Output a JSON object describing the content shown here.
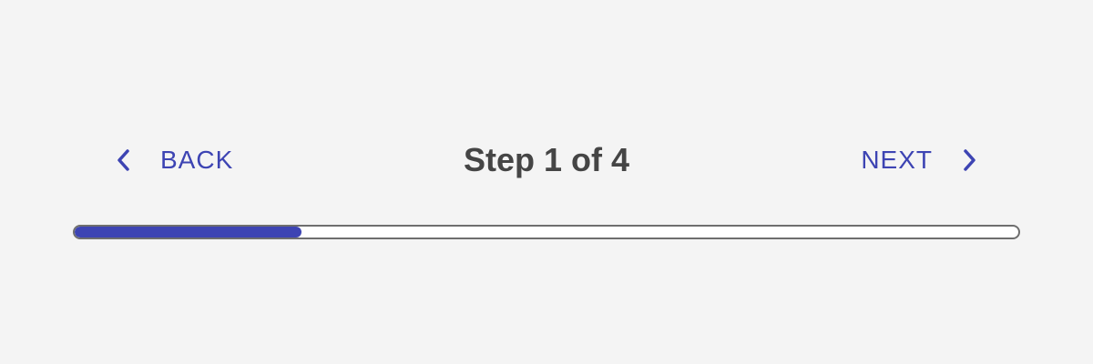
{
  "stepper": {
    "back_label": "BACK",
    "next_label": "NEXT",
    "title": "Step 1 of 4",
    "current_step": 1,
    "total_steps": 4,
    "progress_fraction": 0.24,
    "icons": {
      "back": "chevron-left-icon",
      "next": "chevron-right-icon"
    }
  },
  "colors": {
    "accent": "#3d44b3",
    "title_text": "#454545",
    "background": "#f4f4f4",
    "track_border": "#6e6e6e",
    "track_bg": "#ffffff"
  }
}
